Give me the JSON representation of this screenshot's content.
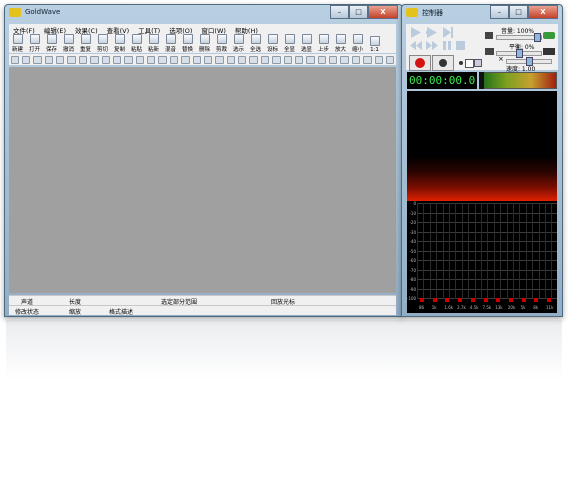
{
  "main_window": {
    "title": "GoldWave",
    "caption_buttons": [
      "–",
      "□",
      "X"
    ],
    "menu": [
      "文件(F)",
      "编辑(E)",
      "效果(C)",
      "查看(V)",
      "工具(T)",
      "选项(O)",
      "窗口(W)",
      "帮助(H)"
    ],
    "toolbar1": [
      {
        "label": "新建",
        "icon": "new-file-icon"
      },
      {
        "label": "打开",
        "icon": "open-folder-icon"
      },
      {
        "label": "保存",
        "icon": "save-icon"
      },
      {
        "label": "撤消",
        "icon": "undo-icon"
      },
      {
        "label": "重复",
        "icon": "redo-icon"
      },
      {
        "label": "剪切",
        "icon": "cut-icon"
      },
      {
        "label": "复制",
        "icon": "copy-icon"
      },
      {
        "label": "粘贴",
        "icon": "paste-icon"
      },
      {
        "label": "粘新",
        "icon": "paste-new-icon"
      },
      {
        "label": "混音",
        "icon": "mix-icon"
      },
      {
        "label": "替换",
        "icon": "replace-icon"
      },
      {
        "label": "删除",
        "icon": "delete-icon"
      },
      {
        "label": "剪裁",
        "icon": "trim-icon"
      },
      {
        "label": "选示",
        "icon": "select-view-icon"
      },
      {
        "label": "全选",
        "icon": "select-all-icon"
      },
      {
        "label": "设标",
        "icon": "set-marker-icon"
      },
      {
        "label": "全显",
        "icon": "show-all-icon"
      },
      {
        "label": "选显",
        "icon": "show-selection-icon"
      },
      {
        "label": "上步",
        "icon": "previous-icon"
      },
      {
        "label": "放大",
        "icon": "zoom-in-icon"
      },
      {
        "label": "缩小",
        "icon": "zoom-out-icon"
      },
      {
        "label": "1:1",
        "icon": "actual-size-icon"
      }
    ],
    "toolbar2_icon_count": 34,
    "status": {
      "col1": "声道",
      "col2": "长度",
      "col3": "选定部分范围",
      "col4": "回放光标",
      "row2_col1": "修改状态",
      "row2_col2": "缩放",
      "row2_col3": "格式描述"
    }
  },
  "control_window": {
    "title": "控制器",
    "caption_buttons": [
      "–",
      "□",
      "X"
    ],
    "volume_label": "音量: 100%",
    "balance_label": "平衡: 0%",
    "speed_label": "速度: 1.00",
    "time_display": "00:00:00.0",
    "volume_fraction": 1.0,
    "balance_fraction": 0.5,
    "speed_fraction": 0.5,
    "y_axis_labels": [
      "0",
      "-10",
      "-20",
      "-30",
      "-40",
      "-50",
      "-60",
      "-70",
      "-80",
      "-90",
      "-100"
    ],
    "x_axis_labels": [
      "86",
      "1k",
      "1.6k",
      "2.7k",
      "4.5k",
      "7.5k",
      "13k",
      "20k",
      "5k",
      "8k",
      "11k"
    ]
  }
}
